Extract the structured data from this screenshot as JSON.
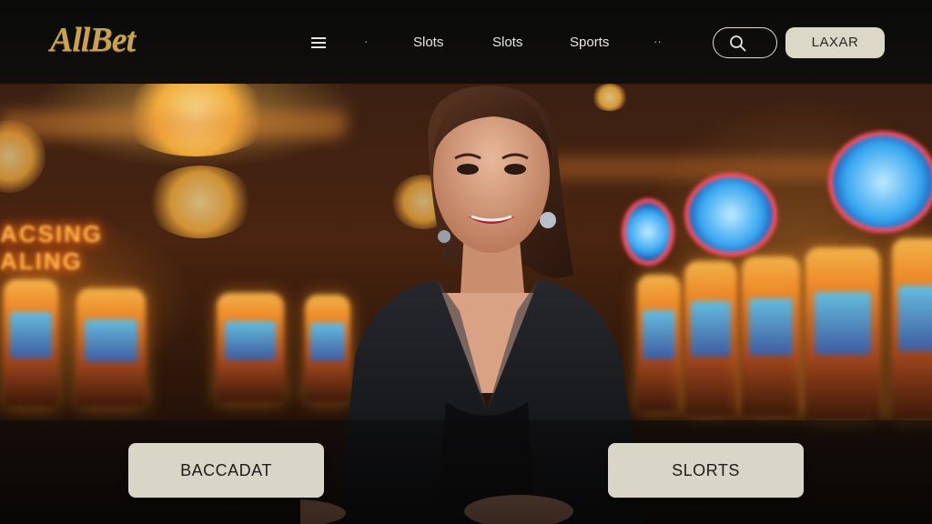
{
  "header": {
    "logo": "AllBet",
    "nav": [
      {
        "label": "Slots"
      },
      {
        "label": "Slots"
      },
      {
        "label": "Sports"
      }
    ],
    "dot_left": "·",
    "dots_right": "··",
    "search_icon": "search-icon",
    "login_label": "LAXAR"
  },
  "hero": {
    "neon_line1": "ACSING",
    "neon_line2": "ALING",
    "cta_left": "BACCADAT",
    "cta_right": "SLORTS"
  },
  "colors": {
    "logo_gold": "#c9a24f",
    "button_bg": "#dcd8c8",
    "header_bg": "#0a0a09"
  }
}
